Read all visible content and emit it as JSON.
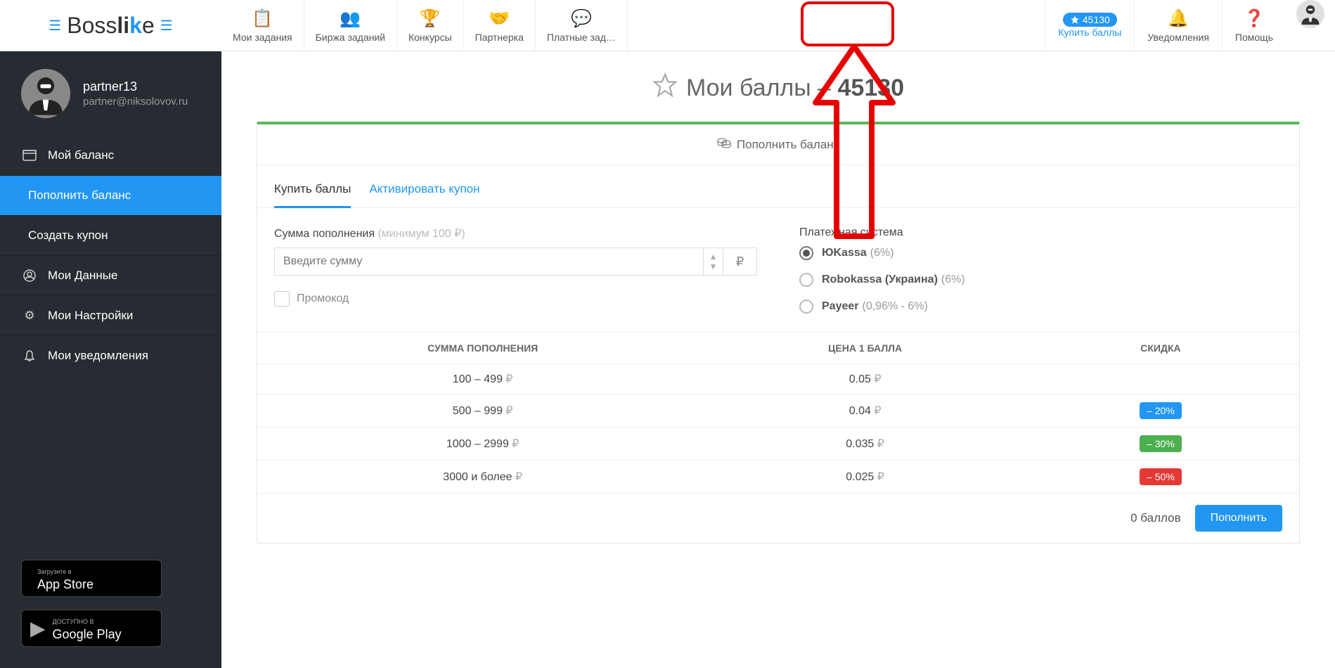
{
  "logo": {
    "pre": "Boss",
    "suf": "li",
    "k": "k",
    "e": "e"
  },
  "nav": {
    "items": [
      {
        "label": "Мои задания"
      },
      {
        "label": "Биржа заданий"
      },
      {
        "label": "Конкурсы"
      },
      {
        "label": "Партнерка"
      },
      {
        "label": "Платные зад…"
      }
    ]
  },
  "right": {
    "points": "45130",
    "buy": "Купить баллы",
    "notifications": "Уведомления",
    "help": "Помощь"
  },
  "user": {
    "name": "partner13",
    "email": "partner@niksolovov.ru"
  },
  "sidebar": {
    "items": [
      {
        "label": "Мой баланс"
      },
      {
        "label": "Пополнить баланс"
      },
      {
        "label": "Создать купон"
      },
      {
        "label": "Мои Данные"
      },
      {
        "label": "Мои Настройки"
      },
      {
        "label": "Мои уведомления"
      }
    ]
  },
  "apps": {
    "appstore_small": "Загрузите в",
    "appstore": "App Store",
    "gplay_small": "ДОСТУПНО В",
    "gplay": "Google Play"
  },
  "page": {
    "title_pre": "Мои баллы – ",
    "title_val": "45130"
  },
  "card": {
    "header": "Пополнить баланс",
    "tabs": {
      "buy": "Купить баллы",
      "coupon": "Активировать купон"
    },
    "sum_label": "Сумма пополнения ",
    "sum_hint": "(минимум 100 ₽)",
    "sum_placeholder": "Введите сумму",
    "currency": "₽",
    "promo": "Промокод",
    "paysys_label": "Платежная система",
    "paysys": [
      {
        "name": "ЮKassa",
        "fee": "(6%)"
      },
      {
        "name": "Robokassa (Украина)",
        "fee": "(6%)"
      },
      {
        "name": "Payeer",
        "fee": "(0,96% - 6%)"
      }
    ],
    "table": {
      "head": {
        "c1": "СУММА ПОПОЛНЕНИЯ",
        "c2": "ЦЕНА 1 БАЛЛА",
        "c3": "СКИДКА"
      },
      "rows": [
        {
          "range": "100 – 499",
          "price": "0.05",
          "discount": "",
          "cls": ""
        },
        {
          "range": "500 – 999",
          "price": "0.04",
          "discount": "– 20%",
          "cls": "disc-blue"
        },
        {
          "range": "1000 – 2999",
          "price": "0.035",
          "discount": "– 30%",
          "cls": "disc-green"
        },
        {
          "range": "3000 и более",
          "price": "0.025",
          "discount": "– 50%",
          "cls": "disc-red"
        }
      ]
    },
    "result": "0 баллов",
    "submit": "Пополнить"
  }
}
